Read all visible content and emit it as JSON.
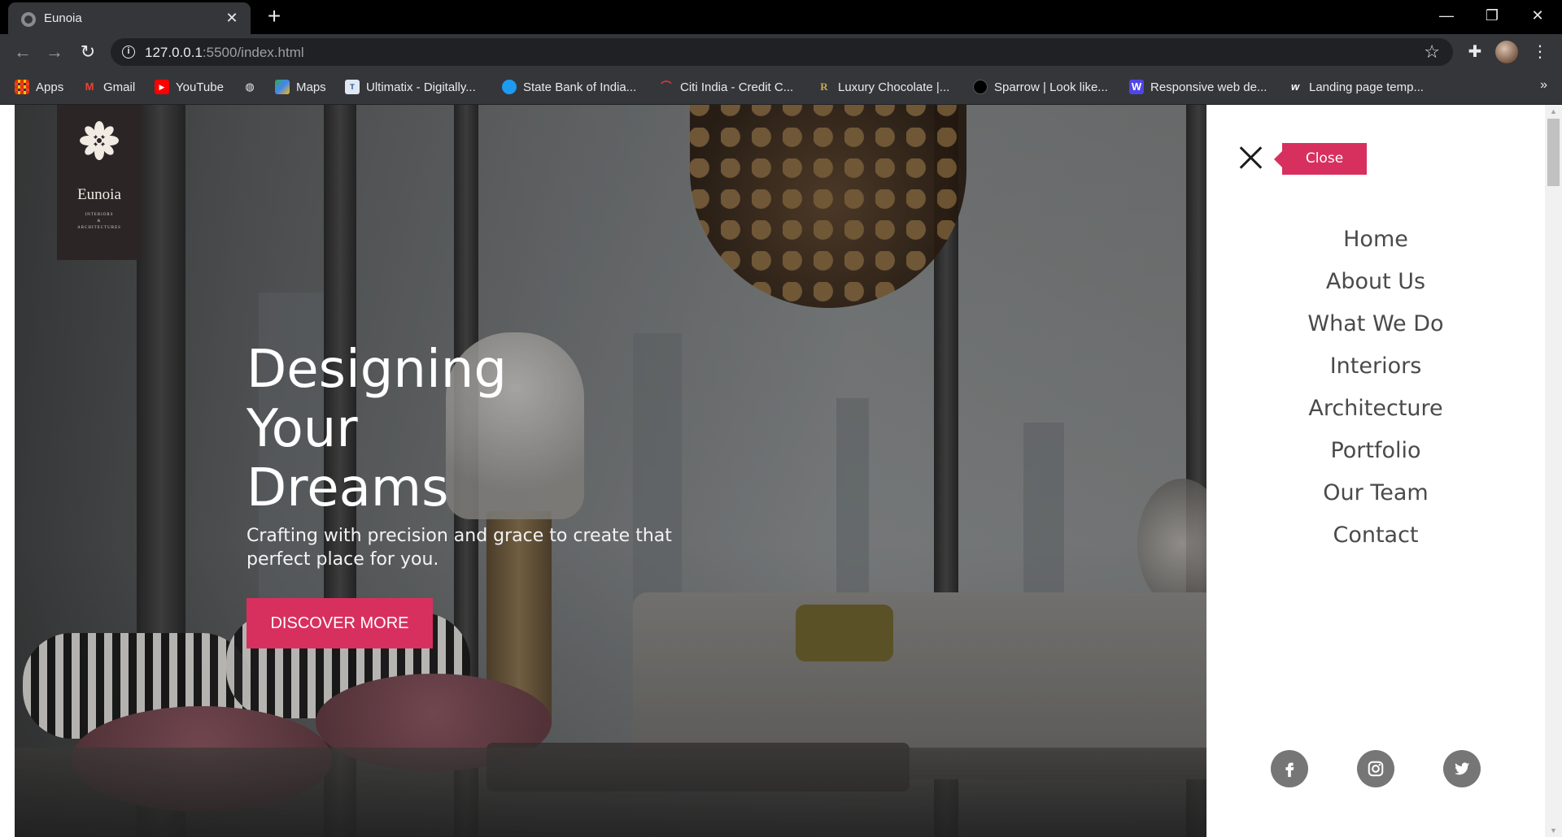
{
  "browser": {
    "tab_title": "Eunoia",
    "url_host": "127.0.0.1",
    "url_path": ":5500/index.html",
    "bookmarks": [
      {
        "label": "Apps",
        "icon": "apps-grid-icon"
      },
      {
        "label": "Gmail",
        "icon": "gmail-icon"
      },
      {
        "label": "YouTube",
        "icon": "youtube-icon"
      },
      {
        "label": "",
        "icon": "globe-icon"
      },
      {
        "label": "Maps",
        "icon": "maps-icon"
      },
      {
        "label": "Ultimatix - Digitally...",
        "icon": "tata-icon"
      },
      {
        "label": "State Bank of India...",
        "icon": "sbi-icon"
      },
      {
        "label": "Citi India - Credit C...",
        "icon": "citi-icon"
      },
      {
        "label": "Luxury Chocolate |...",
        "icon": "r-icon"
      },
      {
        "label": "Sparrow | Look like...",
        "icon": "sparrow-icon"
      },
      {
        "label": "Responsive web de...",
        "icon": "w-icon"
      },
      {
        "label": "Landing page temp...",
        "icon": "w-logo-icon"
      }
    ]
  },
  "logo": {
    "name": "Eunoia",
    "sub_line1": "INTERIORS",
    "sub_line2": "&",
    "sub_line3": "ARCHITECTURES"
  },
  "hero": {
    "title_line1": "Designing",
    "title_line2": "Your",
    "title_line3": "Dreams",
    "subtitle": "Crafting with precision and grace to create that perfect place for you.",
    "cta_label": "DISCOVER MORE"
  },
  "sidemenu": {
    "close_label": "Close",
    "items": [
      "Home",
      "About Us",
      "What We Do",
      "Interiors",
      "Architecture",
      "Portfolio",
      "Our Team",
      "Contact"
    ],
    "social": [
      "facebook-icon",
      "instagram-icon",
      "twitter-icon"
    ]
  },
  "colors": {
    "accent": "#d8305e",
    "logo_bg": "#2b2526",
    "menu_text": "#4a4a4a",
    "social_bg": "#767676"
  }
}
